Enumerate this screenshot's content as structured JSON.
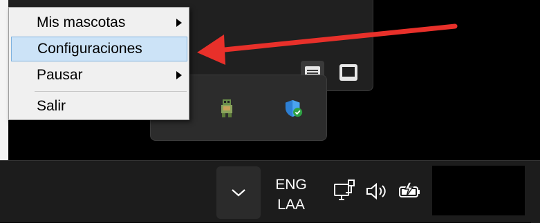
{
  "context_menu": {
    "items": [
      {
        "label": "Mis mascotas",
        "has_submenu": true
      },
      {
        "label": "Configuraciones",
        "highlighted": true
      },
      {
        "label": "Pausar",
        "has_submenu": true
      },
      {
        "label": "Salir"
      }
    ]
  },
  "annotation": {
    "color": "#e8302a"
  },
  "tray_flyout": {
    "icons": [
      "pet-sprite-icon",
      "windows-security-shield-icon"
    ]
  },
  "taskbar": {
    "language": {
      "line1": "ENG",
      "line2": "LAA"
    },
    "icons": [
      "chevron-up-icon",
      "network-ethernet-icon",
      "volume-icon",
      "battery-charging-icon"
    ]
  },
  "colors": {
    "menu_bg": "#f0f0f0",
    "menu_highlight": "#cce3f7",
    "taskbar_bg": "#1c1c1c",
    "shield_blue": "#2d7fd3",
    "check_green": "#2ea043"
  }
}
